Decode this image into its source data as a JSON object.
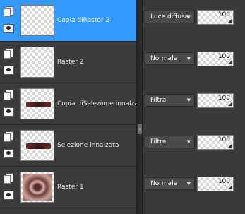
{
  "layers": [
    {
      "name": "Copia diRaster 2",
      "mode": "Luce diffusa",
      "opacity": "100",
      "selected": true,
      "thumb": "checker"
    },
    {
      "name": "Raster 2",
      "mode": "Normale",
      "opacity": "100",
      "selected": false,
      "thumb": "checker"
    },
    {
      "name": "Copia diSelezione innalzata",
      "mode": "Filtra",
      "opacity": "100",
      "selected": false,
      "thumb": "mark"
    },
    {
      "name": "Selezione innalzata",
      "mode": "Filtra",
      "opacity": "100",
      "selected": false,
      "thumb": "mark"
    },
    {
      "name": "Raster 1",
      "mode": "Normale",
      "opacity": "100",
      "selected": false,
      "thumb": "image"
    }
  ],
  "icons": {
    "page": "page-icon",
    "visibility": "eye-icon",
    "dropdown": "chevron-down-icon",
    "splitter": "chevron-right-icon"
  },
  "colors": {
    "selected": "#3399ff",
    "panel": "#3b3b3b",
    "dark": "#262626"
  }
}
